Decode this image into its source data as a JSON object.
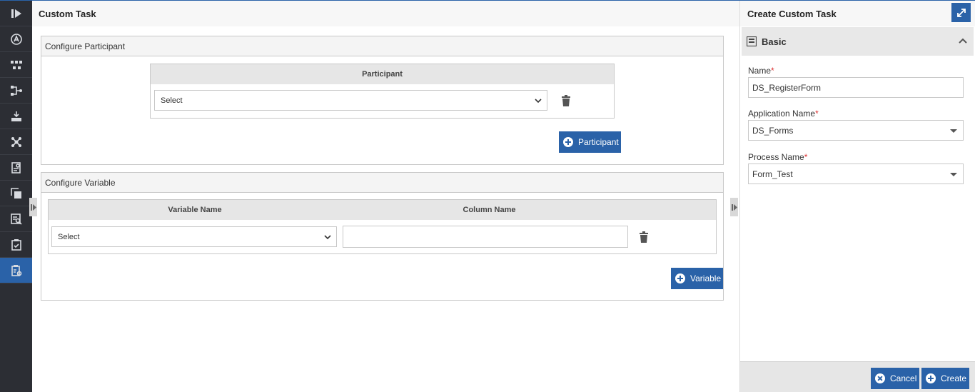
{
  "sidebar": {
    "items": [
      {
        "icon": "play-logo-icon"
      },
      {
        "icon": "app-circle-icon"
      },
      {
        "icon": "process-flow-icon"
      },
      {
        "icon": "workflow-branch-icon"
      },
      {
        "icon": "download-tray-icon"
      },
      {
        "icon": "network-nodes-icon"
      },
      {
        "icon": "form-settings-icon"
      },
      {
        "icon": "layers-icon"
      },
      {
        "icon": "search-report-icon"
      },
      {
        "icon": "checklist-icon"
      },
      {
        "icon": "task-settings-icon"
      }
    ],
    "active_index": 10
  },
  "main": {
    "title": "Custom Task",
    "participant_panel": {
      "title": "Configure Participant",
      "column_header": "Participant",
      "select_value": "Select",
      "add_button_label": "Participant"
    },
    "variable_panel": {
      "title": "Configure Variable",
      "col_variable": "Variable Name",
      "col_column": "Column Name",
      "select_value": "Select",
      "column_value": "",
      "add_button_label": "Variable"
    }
  },
  "right_panel": {
    "title": "Create Custom Task",
    "section": "Basic",
    "fields": {
      "name_label": "Name",
      "name_value": "DS_RegisterForm",
      "app_label": "Application Name",
      "app_value": "DS_Forms",
      "process_label": "Process Name",
      "process_value": "Form_Test",
      "required_mark": "*"
    },
    "cancel_label": "Cancel",
    "create_label": "Create"
  },
  "colors": {
    "accent": "#2a62a8",
    "sidebar_bg": "#2c2e34",
    "required": "#dd3333"
  }
}
